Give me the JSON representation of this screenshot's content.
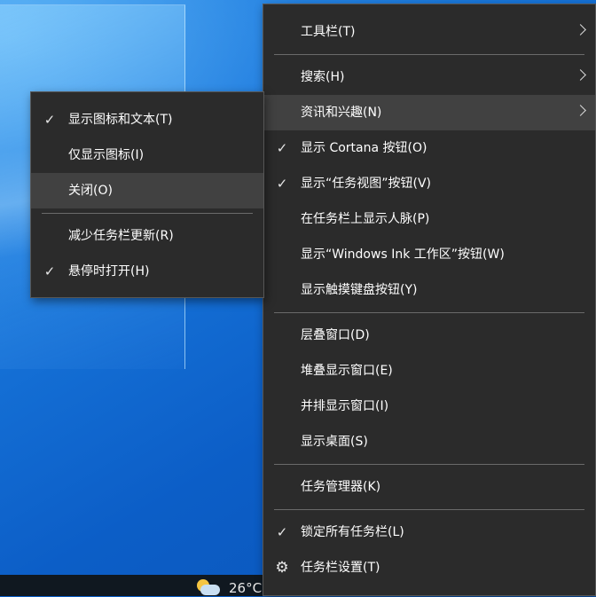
{
  "taskbar": {
    "temperature": "26°C"
  },
  "main_menu": {
    "toolbar": "工具栏(T)",
    "search": "搜索(H)",
    "news_interests": "资讯和兴趣(N)",
    "show_cortana": "显示 Cortana 按钮(O)",
    "show_task_view": "显示“任务视图”按钮(V)",
    "show_people": "在任务栏上显示人脉(P)",
    "show_ink": "显示“Windows Ink 工作区”按钮(W)",
    "show_touch_keyboard": "显示触摸键盘按钮(Y)",
    "cascade": "层叠窗口(D)",
    "stacked": "堆叠显示窗口(E)",
    "side_by_side": "并排显示窗口(I)",
    "show_desktop": "显示桌面(S)",
    "task_manager": "任务管理器(K)",
    "lock_taskbar": "锁定所有任务栏(L)",
    "taskbar_settings": "任务栏设置(T)"
  },
  "sub_menu": {
    "show_icon_text": "显示图标和文本(T)",
    "show_icon_only": "仅显示图标(I)",
    "turn_off": "关闭(O)",
    "reduce_updates": "减少任务栏更新(R)",
    "open_on_hover": "悬停时打开(H)"
  },
  "glyphs": {
    "check": "✓",
    "gear": "⚙"
  }
}
